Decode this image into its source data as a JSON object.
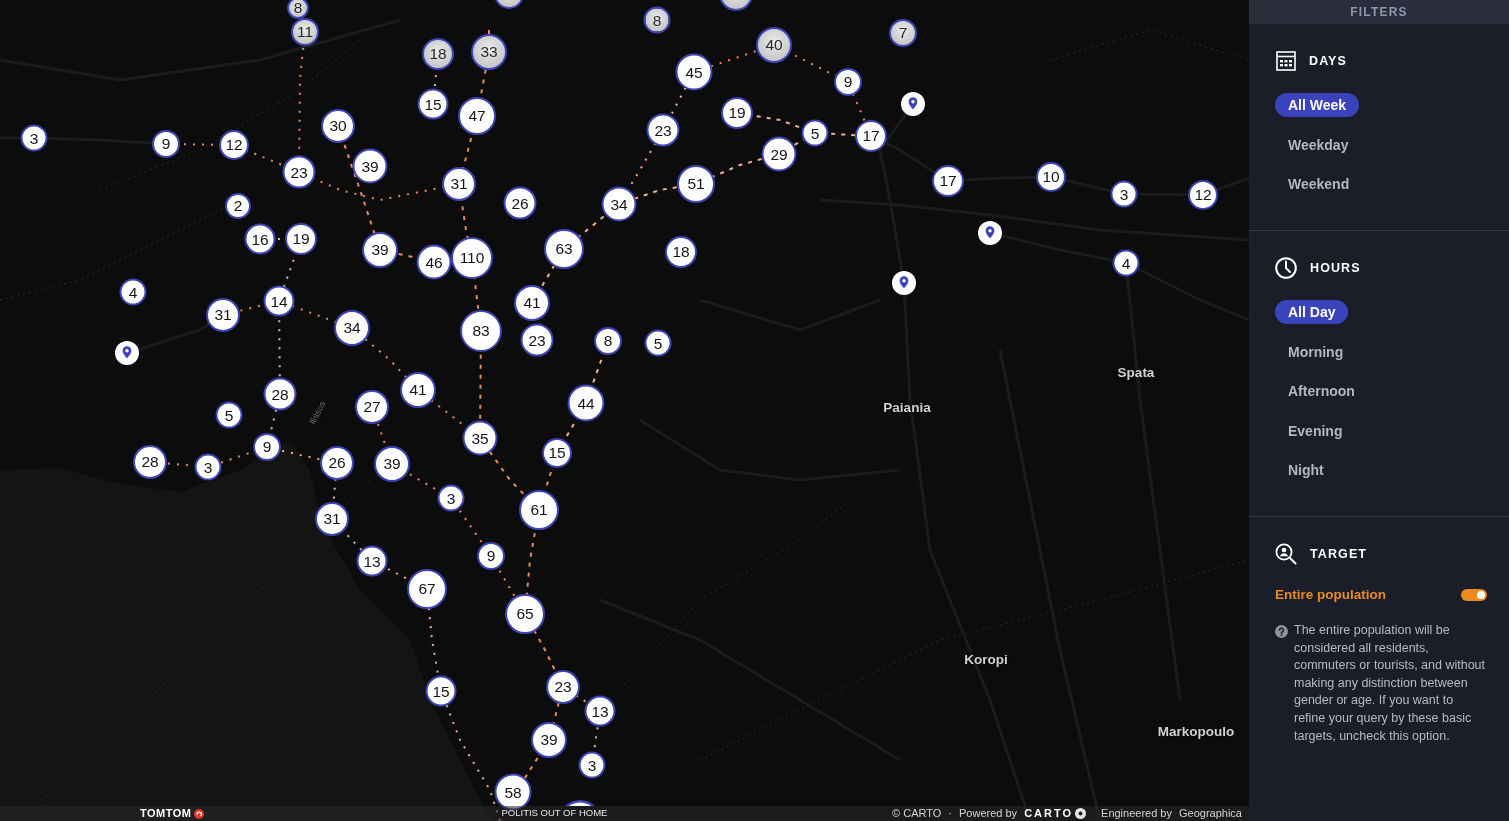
{
  "map": {
    "markers": [
      {
        "kind": "cluster",
        "dimmed": true
      },
      {
        "kind": "cluster",
        "dimmed": true
      },
      {
        "kind": "cluster",
        "label": "8",
        "dimmed": true
      },
      {
        "kind": "cluster",
        "label": "8",
        "dimmed": true
      },
      {
        "kind": "cluster",
        "label": "11",
        "dimmed": true
      },
      {
        "kind": "cluster",
        "label": "7",
        "dimmed": true
      },
      {
        "kind": "cluster",
        "label": "18",
        "dimmed": true
      },
      {
        "kind": "cluster",
        "label": "33",
        "dimmed": true
      },
      {
        "kind": "cluster",
        "label": "40",
        "dimmed": true
      },
      {
        "kind": "cluster",
        "label": "45",
        "dimmed": false
      },
      {
        "kind": "cluster",
        "label": "9",
        "dimmed": false
      },
      {
        "kind": "cluster",
        "label": "15",
        "dimmed": false
      },
      {
        "kind": "cluster",
        "label": "47",
        "dimmed": false
      },
      {
        "kind": "cluster",
        "label": "19",
        "dimmed": false
      },
      {
        "kind": "pin",
        "dimmed": false
      },
      {
        "kind": "cluster",
        "label": "3",
        "dimmed": false
      },
      {
        "kind": "cluster",
        "label": "30",
        "dimmed": false
      },
      {
        "kind": "cluster",
        "label": "23",
        "dimmed": false
      },
      {
        "kind": "cluster",
        "label": "5",
        "dimmed": false
      },
      {
        "kind": "cluster",
        "label": "17",
        "dimmed": false
      },
      {
        "kind": "cluster",
        "label": "9",
        "dimmed": false
      },
      {
        "kind": "cluster",
        "label": "12",
        "dimmed": false
      },
      {
        "kind": "cluster",
        "label": "29",
        "dimmed": false
      },
      {
        "kind": "cluster",
        "label": "23",
        "dimmed": false
      },
      {
        "kind": "cluster",
        "label": "39",
        "dimmed": false
      },
      {
        "kind": "cluster",
        "label": "31",
        "dimmed": false
      },
      {
        "kind": "cluster",
        "label": "51",
        "dimmed": false
      },
      {
        "kind": "cluster",
        "label": "17",
        "dimmed": false
      },
      {
        "kind": "cluster",
        "label": "10",
        "dimmed": false
      },
      {
        "kind": "cluster",
        "label": "3",
        "dimmed": false
      },
      {
        "kind": "cluster",
        "label": "12",
        "dimmed": false
      },
      {
        "kind": "cluster",
        "label": "2",
        "dimmed": false
      },
      {
        "kind": "cluster",
        "label": "26",
        "dimmed": false
      },
      {
        "kind": "cluster",
        "label": "34",
        "dimmed": false
      },
      {
        "kind": "cluster",
        "label": "16",
        "dimmed": false
      },
      {
        "kind": "cluster",
        "label": "19",
        "dimmed": false
      },
      {
        "kind": "pin",
        "dimmed": false
      },
      {
        "kind": "cluster",
        "label": "39",
        "dimmed": false
      },
      {
        "kind": "cluster",
        "label": "46",
        "dimmed": false
      },
      {
        "kind": "cluster",
        "label": "110",
        "dimmed": false
      },
      {
        "kind": "cluster",
        "label": "63",
        "dimmed": false
      },
      {
        "kind": "cluster",
        "label": "18",
        "dimmed": false
      },
      {
        "kind": "cluster",
        "label": "4",
        "dimmed": false
      },
      {
        "kind": "cluster",
        "label": "4",
        "dimmed": false
      },
      {
        "kind": "pin",
        "dimmed": false
      },
      {
        "kind": "cluster",
        "label": "31",
        "dimmed": false
      },
      {
        "kind": "cluster",
        "label": "14",
        "dimmed": false
      },
      {
        "kind": "cluster",
        "label": "41",
        "dimmed": false
      },
      {
        "kind": "cluster",
        "label": "34",
        "dimmed": false
      },
      {
        "kind": "cluster",
        "label": "83",
        "dimmed": false
      },
      {
        "kind": "cluster",
        "label": "23",
        "dimmed": false
      },
      {
        "kind": "cluster",
        "label": "8",
        "dimmed": false
      },
      {
        "kind": "cluster",
        "label": "5",
        "dimmed": false
      },
      {
        "kind": "pin",
        "dimmed": false
      },
      {
        "kind": "cluster",
        "label": "28",
        "dimmed": false
      },
      {
        "kind": "cluster",
        "label": "41",
        "dimmed": false
      },
      {
        "kind": "cluster",
        "label": "44",
        "dimmed": false
      },
      {
        "kind": "cluster",
        "label": "5",
        "dimmed": false
      },
      {
        "kind": "cluster",
        "label": "27",
        "dimmed": false
      },
      {
        "kind": "cluster",
        "label": "9",
        "dimmed": false
      },
      {
        "kind": "cluster",
        "label": "35",
        "dimmed": false
      },
      {
        "kind": "cluster",
        "label": "28",
        "dimmed": false
      },
      {
        "kind": "cluster",
        "label": "3",
        "dimmed": false
      },
      {
        "kind": "cluster",
        "label": "26",
        "dimmed": false
      },
      {
        "kind": "cluster",
        "label": "39",
        "dimmed": false
      },
      {
        "kind": "cluster",
        "label": "15",
        "dimmed": false
      },
      {
        "kind": "cluster",
        "label": "3",
        "dimmed": false
      },
      {
        "kind": "cluster",
        "label": "61",
        "dimmed": false
      },
      {
        "kind": "cluster",
        "label": "31",
        "dimmed": false
      },
      {
        "kind": "cluster",
        "label": "13",
        "dimmed": false
      },
      {
        "kind": "cluster",
        "label": "9",
        "dimmed": false
      },
      {
        "kind": "cluster",
        "label": "67",
        "dimmed": false
      },
      {
        "kind": "cluster",
        "label": "65",
        "dimmed": false
      },
      {
        "kind": "cluster",
        "label": "15",
        "dimmed": false
      },
      {
        "kind": "cluster",
        "label": "23",
        "dimmed": false
      },
      {
        "kind": "cluster",
        "label": "13",
        "dimmed": false
      },
      {
        "kind": "cluster",
        "label": "39",
        "dimmed": false
      },
      {
        "kind": "cluster",
        "label": "3",
        "dimmed": false
      },
      {
        "kind": "cluster",
        "label": "58",
        "dimmed": false
      },
      {
        "kind": "cluster",
        "dimmed": false
      }
    ],
    "place_labels": [
      {
        "kind": "town",
        "text": "Spata"
      },
      {
        "kind": "town",
        "text": "Paiania"
      },
      {
        "kind": "river",
        "text": "Ilissos"
      },
      {
        "kind": "town",
        "text": "Koropi"
      },
      {
        "kind": "town",
        "text": "Markopoulo"
      }
    ]
  },
  "attribution": {
    "logo": "TOMTOM",
    "partner": "POLITIS OUT OF HOME",
    "credit": "© CARTO",
    "separator": "·",
    "powered_by": "Powered by",
    "powered_logo": "CARTO",
    "engineered_by": "Engineered by",
    "engineer": "Geographica"
  },
  "sidebar": {
    "title": "FILTERS",
    "sections": [
      {
        "kind": "days",
        "title": "DAYS",
        "options": [
          {
            "label": "All Week",
            "selected": true
          },
          {
            "label": "Weekday",
            "selected": false
          },
          {
            "label": "Weekend",
            "selected": false
          }
        ]
      },
      {
        "kind": "hours",
        "title": "HOURS",
        "options": [
          {
            "label": "All Day",
            "selected": true
          },
          {
            "label": "Morning",
            "selected": false
          },
          {
            "label": "Afternoon",
            "selected": false
          },
          {
            "label": "Evening",
            "selected": false
          },
          {
            "label": "Night",
            "selected": false
          }
        ]
      },
      {
        "kind": "target",
        "title": "TARGET",
        "toggle": {
          "label": "Entire population",
          "on": true
        },
        "help": "The entire population will be considered all residents, commuters or tourists, and without making any distinction between gender or age. If you want to refine your query by these basic targets, uncheck this option."
      }
    ]
  }
}
